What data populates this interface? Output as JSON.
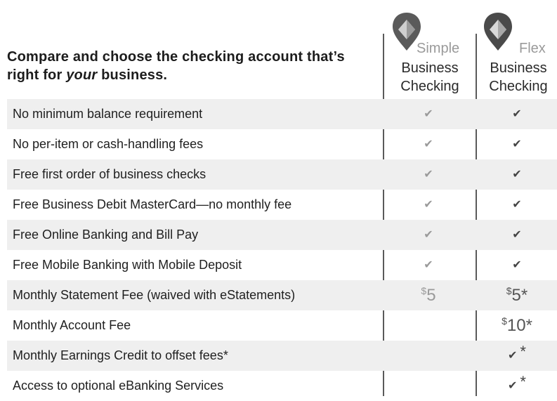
{
  "headline": {
    "part1": "Compare and choose the checking account that’s right for ",
    "emphasis": "your",
    "part2": " business."
  },
  "columns": {
    "simple": {
      "word1": "Simple",
      "word2": "Business",
      "word3": "Checking"
    },
    "flex": {
      "word1": "Flex",
      "word2": "Business",
      "word3": "Checking"
    }
  },
  "icons": {
    "pin": "location-pin-icon",
    "check": "checkmark-icon"
  },
  "colors": {
    "light_grey": "#9a9a9a",
    "dark_grey": "#444444",
    "row_shade": "#efefef"
  },
  "rows": [
    {
      "label": "No minimum balance requirement",
      "simple": "✔",
      "flex": "✔"
    },
    {
      "label": "No per-item or cash-handling fees",
      "simple": "✔",
      "flex": "✔"
    },
    {
      "label": "Free first order of business checks",
      "simple": "✔",
      "flex": "✔"
    },
    {
      "label": "Free Business Debit MasterCard—no monthly fee",
      "simple": "✔",
      "flex": "✔"
    },
    {
      "label": "Free Online Banking and Bill Pay",
      "simple": "✔",
      "flex": "✔"
    },
    {
      "label": "Free Mobile Banking with Mobile Deposit",
      "simple": "✔",
      "flex": "✔"
    },
    {
      "label": "Monthly Statement Fee (waived with eStatements)",
      "simple_currency": "$",
      "simple_amount": "5",
      "flex_currency": "$",
      "flex_amount": "5",
      "flex_note": "*"
    },
    {
      "label": "Monthly Account Fee",
      "flex_currency": "$",
      "flex_amount": "10",
      "flex_note": "*"
    },
    {
      "label": "Monthly Earnings Credit to offset fees*",
      "flex": "✔",
      "flex_note": "*"
    },
    {
      "label": "Access to optional eBanking Services",
      "flex": "✔",
      "flex_note": "*"
    }
  ]
}
